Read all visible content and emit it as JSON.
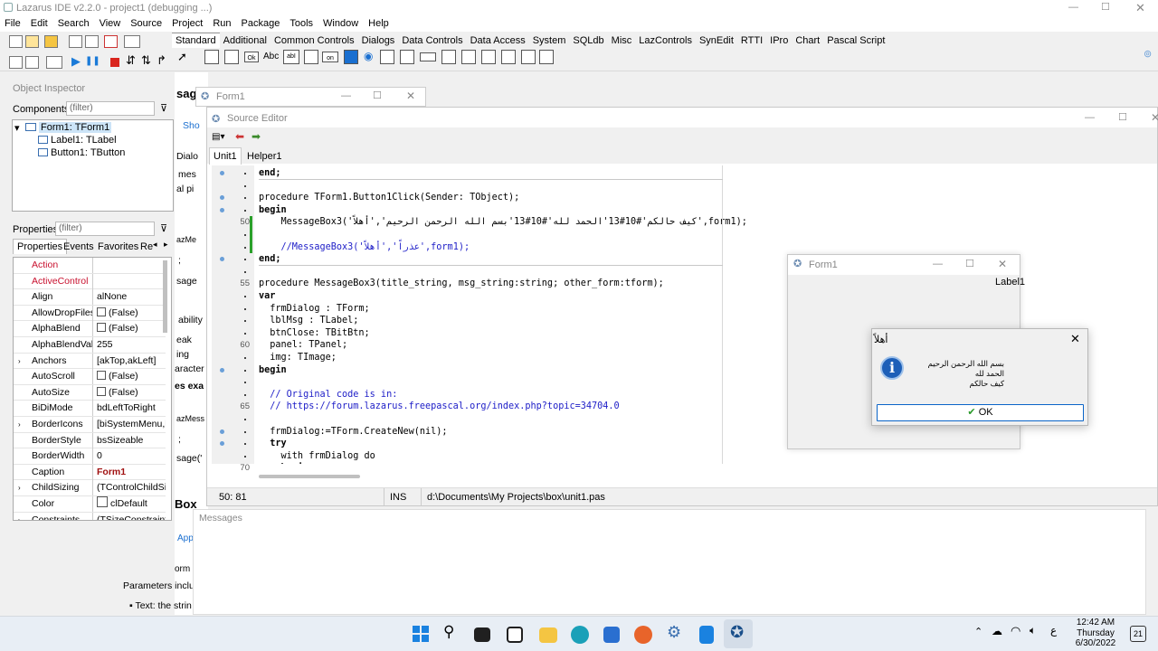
{
  "ide": {
    "title": "Lazarus IDE v2.2.0 - project1 (debugging ...)",
    "menu": [
      "File",
      "Edit",
      "Search",
      "View",
      "Source",
      "Project",
      "Run",
      "Package",
      "Tools",
      "Window",
      "Help"
    ],
    "palette_tabs": [
      "Standard",
      "Additional",
      "Common Controls",
      "Dialogs",
      "Data Controls",
      "Data Access",
      "System",
      "SQLdb",
      "Misc",
      "LazControls",
      "SynEdit",
      "RTTI",
      "IPro",
      "Chart",
      "Pascal Script"
    ],
    "palette_icon_labels": {
      "ok": "Ok",
      "abc": "Abc",
      "abl": "abI",
      "on": "on"
    }
  },
  "object_inspector": {
    "title": "Object Inspector",
    "components_label": "Components",
    "filter_placeholder": "(filter)",
    "tree": [
      "Form1: TForm1",
      "Label1: TLabel",
      "Button1: TButton"
    ],
    "properties_label": "Properties",
    "tabs": [
      "Properties",
      "Events",
      "Favorites",
      "Re"
    ],
    "rows": [
      {
        "name": "Action",
        "value": "",
        "red": true
      },
      {
        "name": "ActiveControl",
        "value": "",
        "red": true
      },
      {
        "name": "Align",
        "value": "alNone"
      },
      {
        "name": "AllowDropFiles",
        "value": "(False)",
        "check": true
      },
      {
        "name": "AlphaBlend",
        "value": "(False)",
        "check": true
      },
      {
        "name": "AlphaBlendValu",
        "value": "255"
      },
      {
        "name": "Anchors",
        "value": "[akTop,akLeft]",
        "expand": true
      },
      {
        "name": "AutoScroll",
        "value": "(False)",
        "check": true
      },
      {
        "name": "AutoSize",
        "value": "(False)",
        "check": true
      },
      {
        "name": "BiDiMode",
        "value": "bdLeftToRight"
      },
      {
        "name": "BorderIcons",
        "value": "[biSystemMenu,l",
        "expand": true
      },
      {
        "name": "BorderStyle",
        "value": "bsSizeable"
      },
      {
        "name": "BorderWidth",
        "value": "0"
      },
      {
        "name": "Caption",
        "value": "Form1",
        "bold": true
      },
      {
        "name": "ChildSizing",
        "value": "(TControlChildSi",
        "expand": true
      },
      {
        "name": "Color",
        "value": "clDefault",
        "swatch": true
      },
      {
        "name": "Constraints",
        "value": "(TSizeConstraint",
        "expand": true
      }
    ]
  },
  "background_doc": {
    "fragments": [
      "sag",
      "Sho",
      "Dialo",
      "mes",
      "al pi",
      "azMe",
      ";",
      "sage",
      "ability",
      "eak",
      "ing",
      "aracter",
      "es exa",
      "azMess",
      ";",
      "sage('",
      "Box",
      "App",
      "orm",
      "Parameters inclu",
      "Text: the strin"
    ]
  },
  "form1_bg": {
    "title": "Form1"
  },
  "source_editor": {
    "title": "Source Editor",
    "tabs": [
      "Unit1",
      "Helper1"
    ],
    "code_lines": [
      {
        "g": "",
        "dot": true,
        "text": "end;",
        "style": "kw"
      },
      {
        "g": "",
        "dot": false,
        "text": "",
        "style": ""
      },
      {
        "g": "",
        "dot": true,
        "text": "procedure TForm1.Button1Click(Sender: TObject);",
        "style": "proc"
      },
      {
        "g": "",
        "dot": true,
        "text": "begin",
        "style": "kw"
      },
      {
        "g": "50",
        "dot": false,
        "text": "    MessageBox3('كيف حالكم'#10#13'الحمد لله'#10#13'بسم الله الرحمن الرحيم','أهلاً',form1);",
        "style": ""
      },
      {
        "g": "",
        "dot": false,
        "text": "",
        "style": ""
      },
      {
        "g": "",
        "dot": false,
        "text": "    //MessageBox3('عذراً','أهلاً',form1);",
        "style": "cmt"
      },
      {
        "g": "",
        "dot": true,
        "text": "end;",
        "style": "kw"
      },
      {
        "g": "",
        "dot": false,
        "text": "",
        "style": ""
      },
      {
        "g": "55",
        "dot": false,
        "text": "procedure MessageBox3(title_string, msg_string:string; other_form:tform);",
        "style": "proc"
      },
      {
        "g": "",
        "dot": false,
        "text": "var",
        "style": "kw"
      },
      {
        "g": "",
        "dot": false,
        "text": "  frmDialog : TForm;",
        "style": ""
      },
      {
        "g": "",
        "dot": false,
        "text": "  lblMsg : TLabel;",
        "style": ""
      },
      {
        "g": "",
        "dot": false,
        "text": "  btnClose: TBitBtn;",
        "style": ""
      },
      {
        "g": "60",
        "dot": false,
        "text": "  panel: TPanel;",
        "style": ""
      },
      {
        "g": "",
        "dot": false,
        "text": "  img: TImage;",
        "style": ""
      },
      {
        "g": "",
        "dot": true,
        "text": "begin",
        "style": "kw"
      },
      {
        "g": "",
        "dot": false,
        "text": "",
        "style": ""
      },
      {
        "g": "",
        "dot": false,
        "text": "  // Original code is in:",
        "style": "cmt"
      },
      {
        "g": "65",
        "dot": false,
        "text": "  // https://forum.lazarus.freepascal.org/index.php?topic=34704.0",
        "style": "cmt"
      },
      {
        "g": "",
        "dot": false,
        "text": "",
        "style": ""
      },
      {
        "g": "",
        "dot": true,
        "text": "  frmDialog:=TForm.CreateNew(nil);",
        "style": ""
      },
      {
        "g": "",
        "dot": true,
        "text": "  try",
        "style": "kw"
      },
      {
        "g": "",
        "dot": false,
        "text": "    with frmDialog do",
        "style": ""
      },
      {
        "g": "70",
        "dot": false,
        "text": "    begin",
        "style": "kw"
      }
    ],
    "status": {
      "position": "50: 81",
      "mode": "INS",
      "file": "d:\\Documents\\My Projects\\box\\unit1.pas"
    }
  },
  "messages": {
    "title": "Messages"
  },
  "form1_small": {
    "title": "Form1",
    "label": "Label1"
  },
  "dialog": {
    "title": "أهلاً",
    "lines": [
      "بسم الله الرحمن الرحيم",
      "الحمد لله",
      "كيف حالكم"
    ],
    "ok_label": "OK"
  },
  "taskbar": {
    "time": "12:42 AM",
    "day": "Thursday",
    "date": "6/30/2022",
    "lang": "ع",
    "notif_count": "21"
  }
}
